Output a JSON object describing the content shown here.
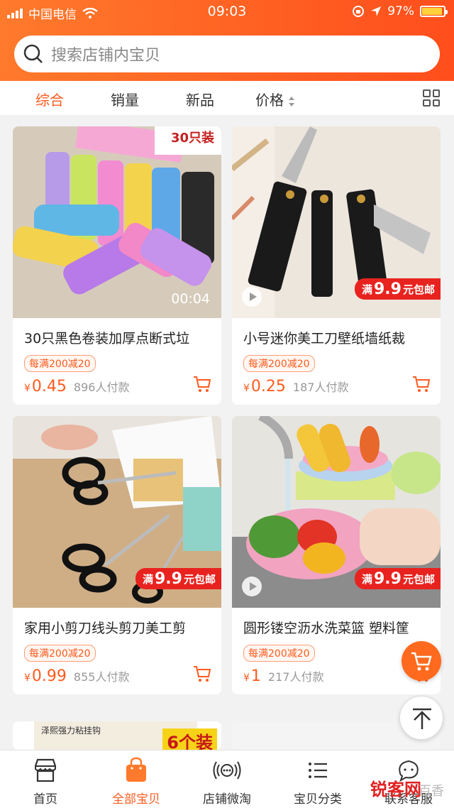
{
  "status_bar": {
    "carrier": "中国电信",
    "time": "09:03",
    "battery": "97%"
  },
  "search": {
    "placeholder": "搜索店铺内宝贝"
  },
  "sort": {
    "items": [
      "综合",
      "销量",
      "新品",
      "价格"
    ],
    "active": "综合"
  },
  "products": [
    {
      "title": "30只黑色卷装加厚点断式垃",
      "promo": "每满200减20",
      "currency": "¥",
      "price": "0.45",
      "paid": "896人付款",
      "video_time": "00:04",
      "img_text": "30只装"
    },
    {
      "title": "小号迷你美工刀壁纸墙纸裁",
      "promo": "每满200减20",
      "currency": "¥",
      "price": "0.25",
      "paid": "187人付款",
      "badge_pre": "满",
      "badge_price": "9.9",
      "badge_post": "元包邮"
    },
    {
      "title": "家用小剪刀线头剪刀美工剪",
      "promo": "每满200减20",
      "currency": "¥",
      "price": "0.99",
      "paid": "855人付款",
      "badge_pre": "满",
      "badge_price": "9.9",
      "badge_post": "元包邮"
    },
    {
      "title": "圆形镂空沥水洗菜篮 塑料筐",
      "promo": "每满200减20",
      "currency": "¥",
      "price": "1",
      "paid": "217人付款",
      "badge_pre": "满",
      "badge_price": "9.9",
      "badge_post": "元包邮"
    }
  ],
  "peek": {
    "left_text": "6个装",
    "left_brand": "泽熙强力粘挂钩"
  },
  "tabbar": {
    "items": [
      "首页",
      "全部宝贝",
      "店铺微淘",
      "宝贝分类",
      "联系客服"
    ],
    "active": "全部宝贝"
  },
  "watermark": {
    "text": "锐客网",
    "sub": "百香"
  },
  "colors": {
    "accent": "#ff5b1f",
    "header_start": "#ff7a2c",
    "header_end": "#ff4e1c",
    "badge_red": "#e8231f"
  }
}
